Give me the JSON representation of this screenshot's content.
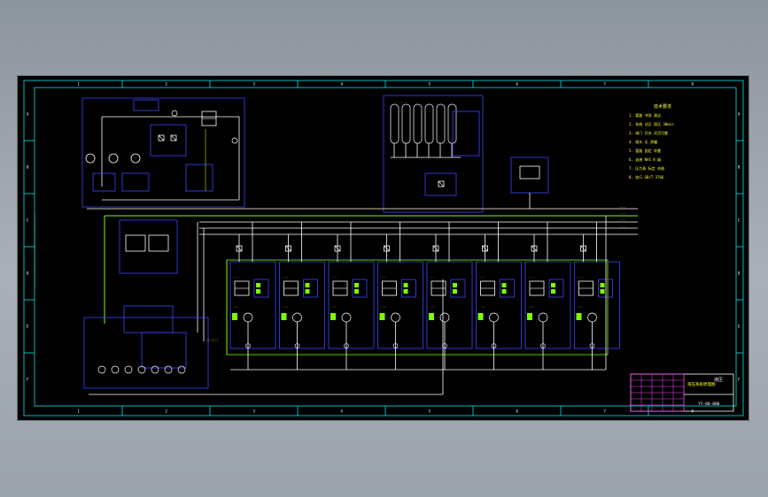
{
  "drawing": {
    "notes_title": "技术要求",
    "notes": [
      "1. 管路 冲洗 清洁",
      "2. 系统 试压 保压 30min",
      "3. 阀门 开关 灵活可靠",
      "4. 接头 无 渗漏",
      "5. 管路 固定 牢靠",
      "6. 油液 NAS 8 级",
      "7. 压力表 标定 合格",
      "8. 执行 GB/T 3766"
    ],
    "title_block": {
      "drawing_name": "液压系统原理图",
      "company": "液压",
      "drawing_no": "YY-00-000"
    },
    "border_numbers": [
      "1",
      "2",
      "3",
      "4",
      "5",
      "6",
      "7",
      "8"
    ],
    "border_letters": [
      "A",
      "B",
      "C",
      "D",
      "E",
      "F"
    ]
  },
  "branch_count": 8,
  "colors": {
    "sheet": "#000000",
    "border": "#00e5ee",
    "outline": "#3d45ff",
    "line": "#ffffff",
    "bus": "#7cfc00",
    "text": "#ffff33",
    "accent": "#ff40ff"
  }
}
